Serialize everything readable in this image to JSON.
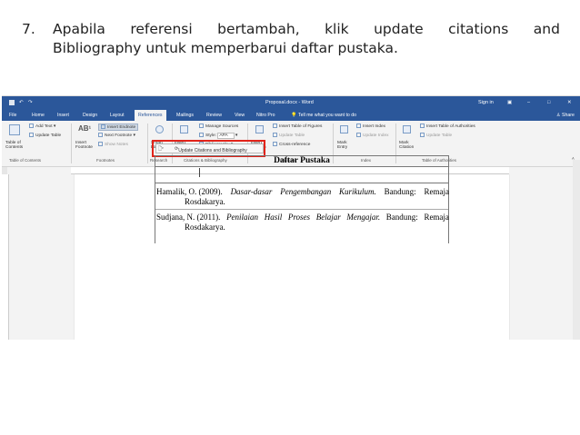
{
  "instruction": {
    "number": "7.",
    "line1": [
      "Apabila",
      "referensi",
      "bertambah,",
      "klik",
      "update",
      "citations",
      "and"
    ],
    "line2": "Bibliography untuk memperbarui daftar pustaka."
  },
  "window": {
    "title": "Proposal.docx - Word",
    "signin": "Sign in",
    "share": "Share",
    "tell_me": "Tell me what you want to do"
  },
  "tabs": [
    "File",
    "Home",
    "Insert",
    "Design",
    "Layout",
    "References",
    "Mailings",
    "Review",
    "View",
    "Nitro Pro"
  ],
  "ribbon": {
    "table_of_contents": "Table of Contents",
    "add_text": "Add Text",
    "update_table": "Update Table",
    "group_toc": "Table of Contents",
    "insert_footnote": "Insert Footnote",
    "insert_endnote": "Insert Endnote",
    "next_footnote": "Next Footnote",
    "show_notes": "Show Notes",
    "group_footnotes": "Footnotes",
    "smart_lookup": "Smart Lookup",
    "group_research": "Research",
    "insert_citation": "Insert Citation",
    "manage_sources": "Manage Sources",
    "style_label": "Style:",
    "style_value": "APA",
    "bibliography": "Bibliography",
    "group_citations": "Citations & Bibliography",
    "insert_caption": "Insert Caption",
    "insert_table_of_figures": "Insert Table of Figures",
    "update_table_captions": "Update Table",
    "cross_reference": "Cross-reference",
    "group_captions": "Captions",
    "mark_entry": "Mark Entry",
    "insert_index": "Insert Index",
    "update_index": "Update Index",
    "group_index": "Index",
    "mark_citation": "Mark Citation",
    "insert_table_of_authorities": "Insert Table of Authorities",
    "update_table_auth": "Update Table",
    "group_authorities": "Table of Authorities"
  },
  "content_control": {
    "update_button": "Update Citations and Bibliography"
  },
  "bibliography": {
    "heading": "Daftar Pustaka",
    "entries": [
      {
        "author_year": "Hamalik, O. (2009).",
        "title_words": [
          "Dasar-dasar",
          "Pengembangan",
          "Kurikulum."
        ],
        "place": "Bandung:",
        "publisher_start": "Remaja",
        "publisher_end": "Rosdakarya."
      },
      {
        "author_year": "Sudjana, N. (2011).",
        "title_words": [
          "Penilaian",
          "Hasil",
          "Proses",
          "Belajar",
          "Mengajar."
        ],
        "place": "Bandung:",
        "publisher_start": "Remaja",
        "publisher_end": "Rosdakarya."
      }
    ]
  },
  "colors": {
    "word_blue": "#2b579a",
    "highlight_red": "#e2231a"
  }
}
